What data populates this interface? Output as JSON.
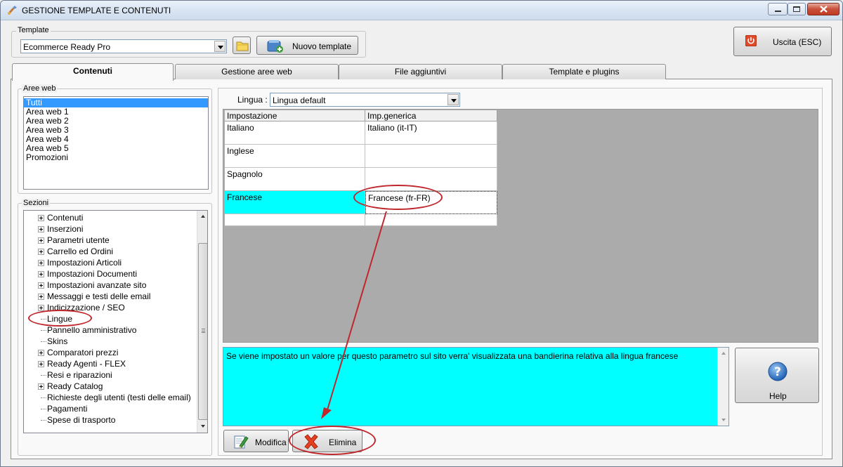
{
  "window": {
    "title": "GESTIONE TEMPLATE E CONTENUTI"
  },
  "template_group": {
    "label": "Template",
    "selected": "Ecommerce Ready Pro",
    "new_button": "Nuovo template"
  },
  "exit_button": "Uscita (ESC)",
  "tabs": [
    {
      "label": "Contenuti",
      "active": true
    },
    {
      "label": "Gestione aree web",
      "active": false
    },
    {
      "label": "File aggiuntivi",
      "active": false
    },
    {
      "label": "Template e plugins",
      "active": false
    }
  ],
  "aree_web": {
    "label": "Aree web",
    "items": [
      "Tutti",
      "Area web 1",
      "Area web 2",
      "Area web 3",
      "Area web 4",
      "Area web 5",
      "Promozioni"
    ],
    "selected_index": 0
  },
  "sezioni": {
    "label": "Sezioni",
    "items": [
      {
        "label": "Contenuti",
        "expandable": true
      },
      {
        "label": "Inserzioni",
        "expandable": true
      },
      {
        "label": "Parametri utente",
        "expandable": true
      },
      {
        "label": "Carrello ed Ordini",
        "expandable": true
      },
      {
        "label": "Impostazioni Articoli",
        "expandable": true
      },
      {
        "label": "Impostazioni Documenti",
        "expandable": true
      },
      {
        "label": "Impostazioni avanzate sito",
        "expandable": true
      },
      {
        "label": "Messaggi e testi delle email",
        "expandable": true
      },
      {
        "label": "Indicizzazione / SEO",
        "expandable": true
      },
      {
        "label": "Lingue",
        "expandable": false
      },
      {
        "label": "Pannello amministrativo",
        "expandable": false
      },
      {
        "label": "Skins",
        "expandable": false
      },
      {
        "label": "Comparatori prezzi",
        "expandable": true
      },
      {
        "label": "Ready Agenti - FLEX",
        "expandable": true
      },
      {
        "label": "Resi e riparazioni",
        "expandable": false
      },
      {
        "label": "Ready Catalog",
        "expandable": true
      },
      {
        "label": "Richieste degli utenti (testi delle email)",
        "expandable": false
      },
      {
        "label": "Pagamenti",
        "expandable": false
      },
      {
        "label": "Spese di trasporto",
        "expandable": false
      }
    ]
  },
  "lingua": {
    "label": "Lingua :",
    "selected": "Lingua default"
  },
  "grid": {
    "headers": [
      "Impostazione",
      "Imp.generica"
    ],
    "rows": [
      {
        "setting": "Italiano",
        "value": "Italiano (it-IT)",
        "selected": false
      },
      {
        "setting": "Inglese",
        "value": "",
        "selected": false
      },
      {
        "setting": "Spagnolo",
        "value": "",
        "selected": false
      },
      {
        "setting": "Francese",
        "value": "Francese (fr-FR)",
        "selected": true
      }
    ]
  },
  "description": "Se viene impostato un valore per questo parametro sul sito verra' visualizzata una bandierina relativa alla lingua francese",
  "help_button": "Help",
  "modifica_button": "Modifica",
  "elimina_button": "Elimina",
  "colors": {
    "selection": "#3399ff",
    "highlight": "#00ffff",
    "annotation": "#c0272d"
  }
}
